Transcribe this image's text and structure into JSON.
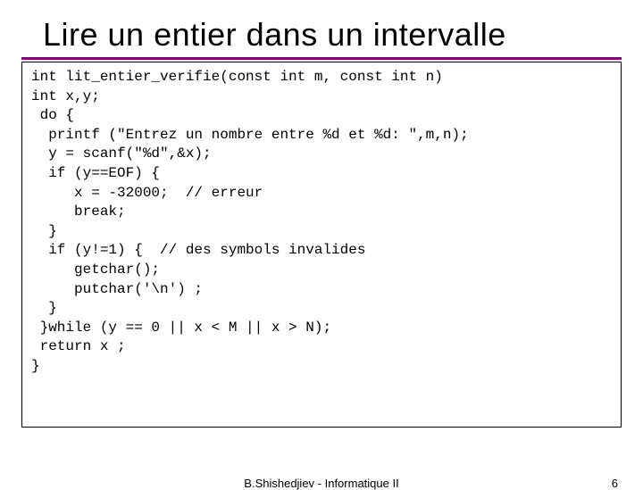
{
  "title": "Lire un entier dans un intervalle",
  "code": "int lit_entier_verifie(const int m, const int n)\nint x,y;\n do {\n  printf (\"Entrez un nombre entre %d et %d: \",m,n);\n  y = scanf(\"%d\",&x);\n  if (y==EOF) {\n     x = -32000;  // erreur\n     break;\n  }\n  if (y!=1) {  // des symbols invalides\n     getchar();\n     putchar('\\n') ;\n  }\n }while (y == 0 || x < M || x > N);\n return x ;\n}",
  "footer_author": "B.Shishedjiev - Informatique II",
  "footer_page": "6"
}
